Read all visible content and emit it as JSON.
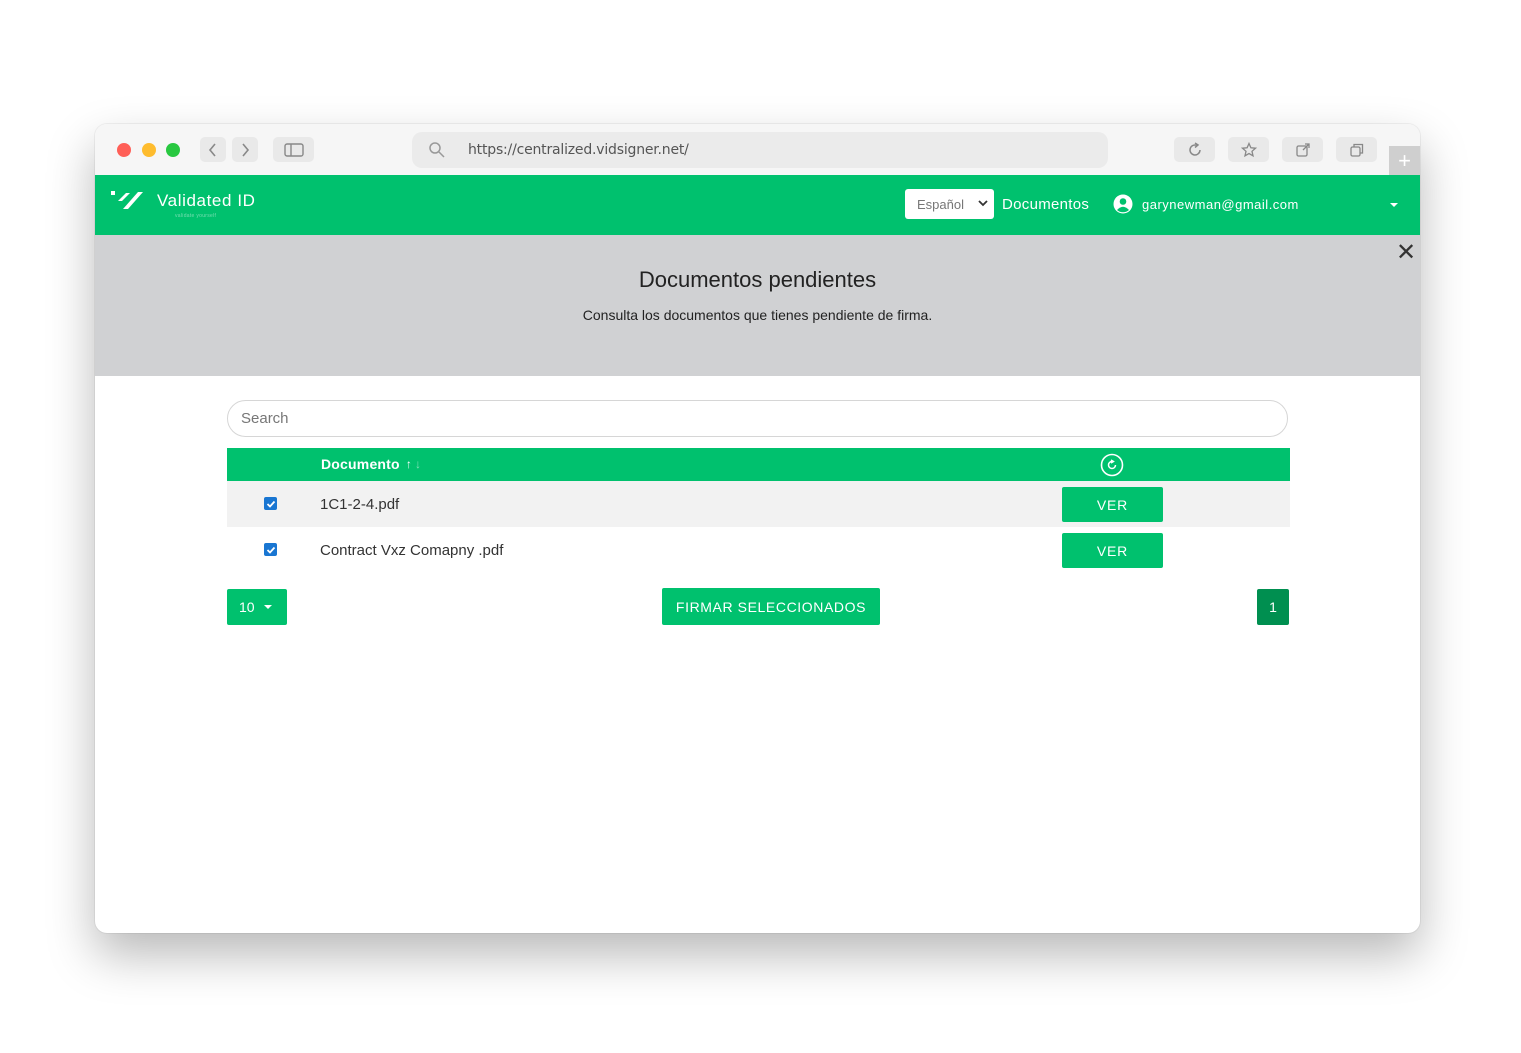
{
  "browser": {
    "url": "https://centralized.vidsigner.net/",
    "new_tab_symbol": "+"
  },
  "navbar": {
    "brand": "Validated ID",
    "brand_tagline": "validate yourself",
    "language": "Español",
    "documents_link": "Documentos",
    "user_email": "garynewman@gmail.com"
  },
  "banner": {
    "title": "Documentos pendientes",
    "subtitle": "Consulta los documentos que tienes pendiente de firma.",
    "close_symbol": "✕"
  },
  "search": {
    "placeholder": "Search"
  },
  "table": {
    "column_document": "Documento",
    "sort_up": "↑",
    "sort_down": "↓",
    "rows": [
      {
        "filename": "1C1-2-4.pdf",
        "checked": true,
        "action": "VER"
      },
      {
        "filename": "Contract Vxz Comapny .pdf",
        "checked": true,
        "action": "VER"
      }
    ]
  },
  "footer": {
    "page_size": "10",
    "sign_selected": "FIRMAR SELECCIONADOS",
    "current_page": "1"
  },
  "colors": {
    "brand_green": "#00c16e",
    "active_page_green": "#008f50",
    "banner_gray": "#d0d1d3",
    "checkbox_blue": "#1976d2"
  }
}
